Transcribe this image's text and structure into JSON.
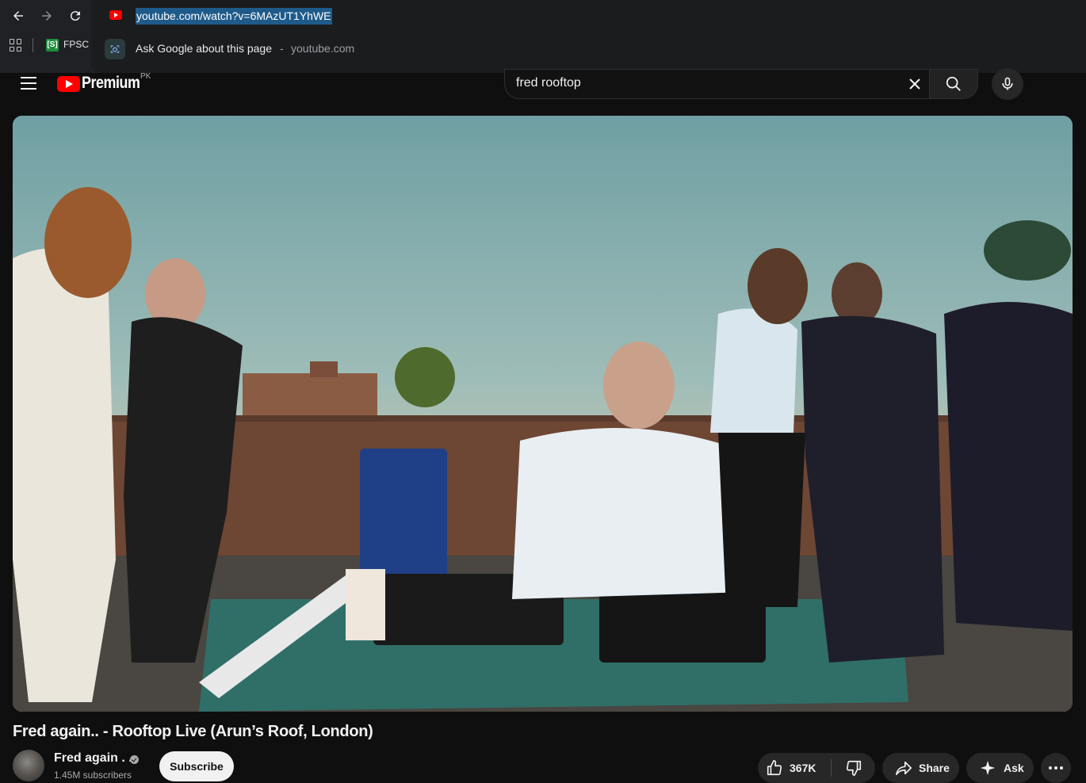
{
  "browser": {
    "url": "youtube.com/watch?v=6MAzUT1YhWE",
    "suggestion_text": "Ask Google about this page",
    "suggestion_separator": "-",
    "suggestion_domain": "youtube.com",
    "bookmark_label": "FPSC E",
    "bookmark_icon_text": "[S]"
  },
  "masthead": {
    "logo_text": "Premium",
    "country_code": "PK",
    "search_query": "fred rooftop"
  },
  "video": {
    "title": "Fred again.. - Rooftop Live (Arun’s Roof, London)",
    "channel_name": "Fred again . .",
    "subscribers": "1.45M subscribers",
    "subscribe_label": "Subscribe",
    "like_count": "367K",
    "share_label": "Share",
    "ask_label": "Ask"
  },
  "colors": {
    "brand_red": "#ff0000",
    "background": "#0f0f0f",
    "url_highlight": "#1f5b8a"
  }
}
